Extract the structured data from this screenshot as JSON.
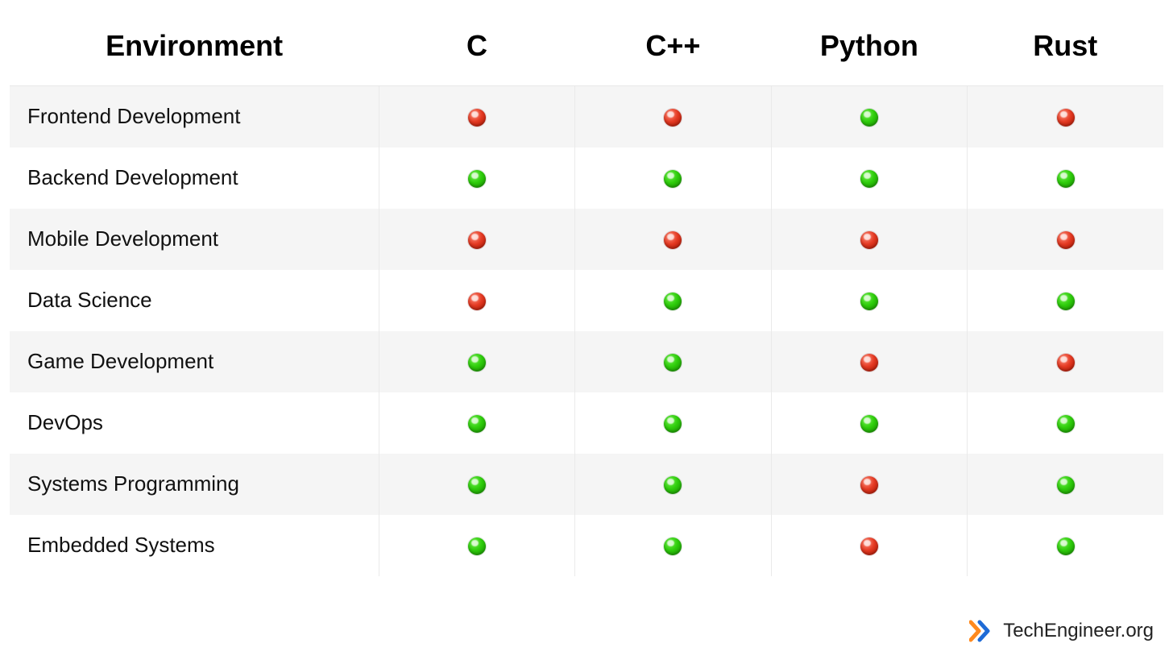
{
  "chart_data": {
    "type": "table",
    "title": "",
    "columns": [
      "Environment",
      "C",
      "C++",
      "Python",
      "Rust"
    ],
    "rows": [
      {
        "environment": "Frontend Development",
        "C": false,
        "C++": false,
        "Python": true,
        "Rust": false
      },
      {
        "environment": "Backend Development",
        "C": true,
        "C++": true,
        "Python": true,
        "Rust": true
      },
      {
        "environment": "Mobile Development",
        "C": false,
        "C++": false,
        "Python": false,
        "Rust": false
      },
      {
        "environment": "Data Science",
        "C": false,
        "C++": true,
        "Python": true,
        "Rust": true
      },
      {
        "environment": "Game Development",
        "C": true,
        "C++": true,
        "Python": false,
        "Rust": false
      },
      {
        "environment": "DevOps",
        "C": true,
        "C++": true,
        "Python": true,
        "Rust": true
      },
      {
        "environment": "Systems Programming",
        "C": true,
        "C++": true,
        "Python": false,
        "Rust": true
      },
      {
        "environment": "Embedded Systems",
        "C": true,
        "C++": true,
        "Python": false,
        "Rust": true
      }
    ],
    "legend": {
      "true": "green",
      "false": "red"
    }
  },
  "footer": {
    "site": "TechEngineer.org"
  }
}
